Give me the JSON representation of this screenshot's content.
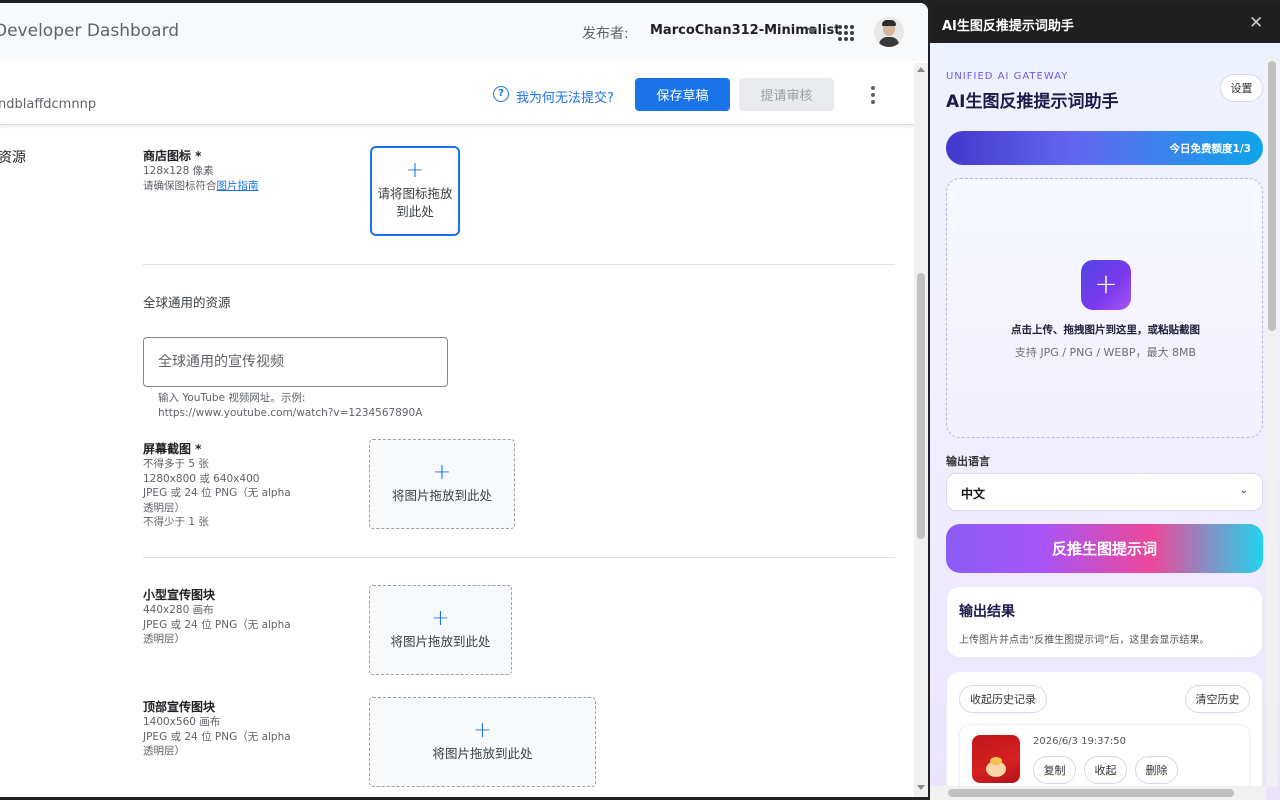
{
  "dashboard": {
    "title": "Developer Dashboard",
    "publisher_label": "发布者:",
    "publisher_name": "MarcoChan312-Minimalist",
    "item_id": "ndblaffdcmnnp",
    "why_cant_submit": "我为何无法提交?",
    "save_draft": "保存草稿",
    "submit_review": "提请审核",
    "section_assets": "资源",
    "store_icon": {
      "label": "商店图标 *",
      "size": "128x128 像素",
      "guide_prefix": "请确保图标符合",
      "guide_link": "图片指南",
      "drop_text": "请将图标拖放到此处"
    },
    "global_assets_title": "全球通用的资源",
    "promo_video": {
      "placeholder": "全球通用的宣传视频",
      "hint_line1": "输入 YouTube 视频网址。示例:",
      "hint_line2": "https://www.youtube.com/watch?v=1234567890A"
    },
    "screenshots": {
      "label": "屏幕截图 *",
      "lines": [
        "不得多于 5 张",
        "1280x800 或 640x400",
        "JPEG 或 24 位 PNG（无 alpha",
        "透明层）",
        "不得少于 1 张"
      ],
      "drop_text": "将图片拖放到此处"
    },
    "small_promo": {
      "label": "小型宣传图块",
      "lines": [
        "440x280 画布",
        "JPEG 或 24 位 PNG（无 alpha",
        "透明层）"
      ],
      "drop_text": "将图片拖放到此处"
    },
    "marquee_promo": {
      "label": "顶部宣传图块",
      "lines": [
        "1400x560 画布",
        "JPEG 或 24 位 PNG（无 alpha",
        "透明层）"
      ],
      "drop_text": "将图片拖放到此处"
    }
  },
  "panel": {
    "header_title": "AI生图反推提示词助手",
    "close_glyph": "✕",
    "gateway_label": "UNIFIED AI GATEWAY",
    "title": "AI生图反推提示词助手",
    "settings": "设置",
    "quota": "今日免费额度1/3",
    "upload_hint": "点击上传、拖拽图片到这里，或粘贴截图",
    "upload_formats": "支持 JPG / PNG / WEBP，最大 8MB",
    "lang_label": "输出语言",
    "lang_value": "中文",
    "reverse_button": "反推生图提示词",
    "result_title": "输出结果",
    "result_desc": "上传图片并点击“反推生图提示词”后，这里会显示结果。",
    "collapse_history": "收起历史记录",
    "clear_history": "清空历史",
    "history_time": "2026/6/3 19:37:50",
    "copy": "复制",
    "fold": "收起",
    "delete": "删除"
  },
  "colors": {
    "accent_blue": "#1a73e8",
    "panel_purple": "#6c5ce7"
  }
}
